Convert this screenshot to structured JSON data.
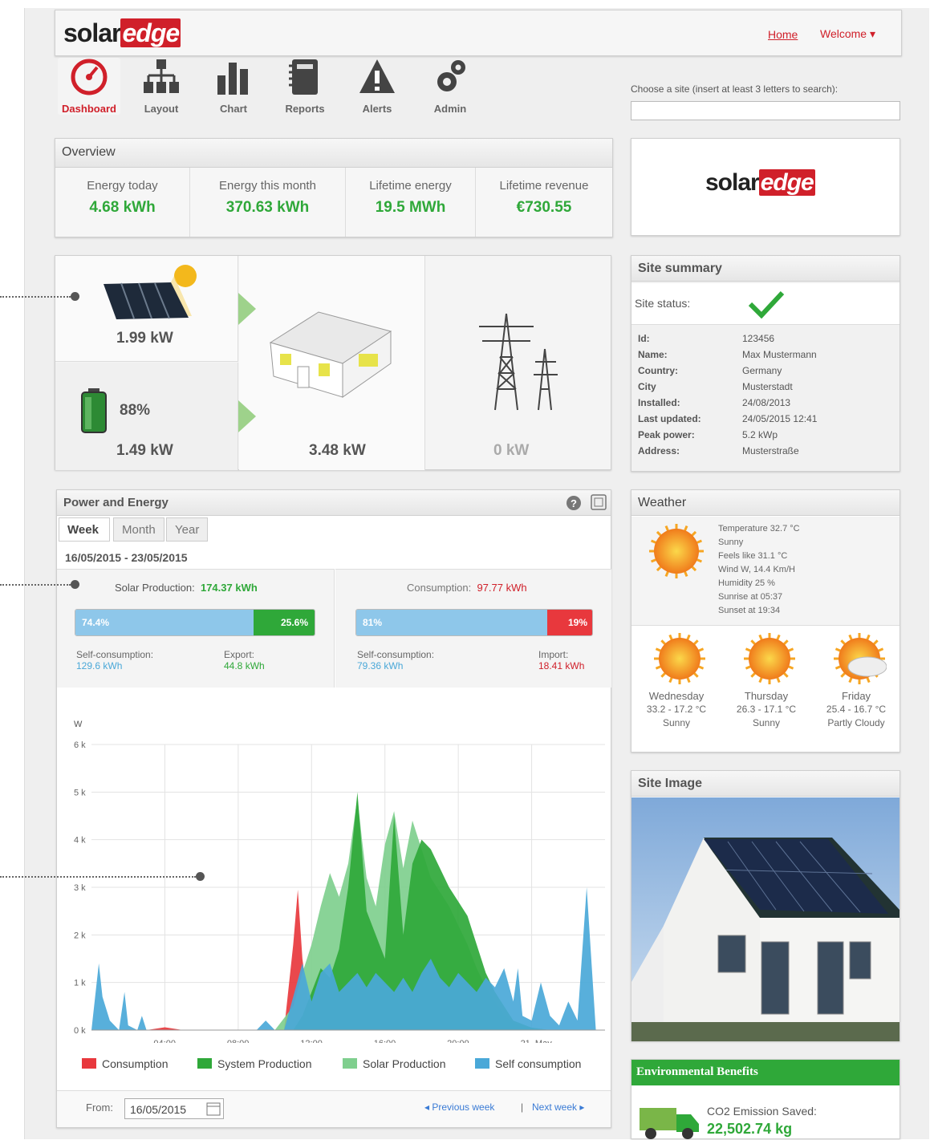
{
  "brand": {
    "solar": "solar",
    "edge": "edge"
  },
  "topnav": {
    "home": "Home",
    "welcome": "Welcome ▾"
  },
  "nav": [
    {
      "label": "Dashboard",
      "icon": "gauge-icon",
      "active": true
    },
    {
      "label": "Layout",
      "icon": "layout-icon"
    },
    {
      "label": "Chart",
      "icon": "chart-icon"
    },
    {
      "label": "Reports",
      "icon": "reports-icon"
    },
    {
      "label": "Alerts",
      "icon": "alert-icon"
    },
    {
      "label": "Admin",
      "icon": "gear-icon"
    }
  ],
  "search": {
    "label": "Choose a site (insert at least 3 letters to search):",
    "value": ""
  },
  "overview": {
    "title": "Overview",
    "items": [
      {
        "label": "Energy today",
        "value": "4.68 kWh"
      },
      {
        "label": "Energy this month",
        "value": "370.63 kWh"
      },
      {
        "label": "Lifetime energy",
        "value": "19.5 MWh"
      },
      {
        "label": "Lifetime revenue",
        "value": "€730.55"
      }
    ]
  },
  "flow": {
    "solar": "1.99 kW",
    "battery_pct": "88%",
    "battery": "1.49 kW",
    "house": "3.48 kW",
    "grid": "0 kW"
  },
  "summary": {
    "title": "Site summary",
    "status_label": "Site status:",
    "rows": [
      {
        "k": "Id:",
        "v": "123456"
      },
      {
        "k": "Name:",
        "v": "Max Mustermann"
      },
      {
        "k": "Country:",
        "v": "Germany"
      },
      {
        "k": "City",
        "v": "Musterstadt"
      },
      {
        "k": "Installed:",
        "v": "24/08/2013"
      },
      {
        "k": "Last updated:",
        "v": "24/05/2015 12:41"
      },
      {
        "k": "Peak power:",
        "v": "5.2 kWp"
      },
      {
        "k": "Address:",
        "v": "Musterstraße"
      }
    ]
  },
  "pe": {
    "title": "Power and Energy",
    "tabs": [
      "Week",
      "Month",
      "Year"
    ],
    "range": "16/05/2015 - 23/05/2015",
    "solar_label": "Solar Production:",
    "solar_value": "174.37 kWh",
    "solar_left_pct": "74.4%",
    "solar_right_pct": "25.6%",
    "self_label": "Self-consumption:",
    "self_value": "129.6 kWh",
    "export_label": "Export:",
    "export_value": "44.8 kWh",
    "cons_label": "Consumption:",
    "cons_value": "97.77 kWh",
    "cons_left_pct": "81%",
    "cons_right_pct": "19%",
    "self2_label": "Self-consumption:",
    "self2_value": "79.36 kWh",
    "import_label": "Import:",
    "import_value": "18.41 kWh",
    "from_label": "From:",
    "from_value": "16/05/2015",
    "prev": "◂ Previous week",
    "sep": "|",
    "next": "Next week ▸"
  },
  "chart_data": {
    "type": "area",
    "ylabel": "W",
    "yticks": [
      "0 k",
      "1 k",
      "2 k",
      "3 k",
      "4 k",
      "5 k",
      "6 k"
    ],
    "ylim": [
      0,
      6000
    ],
    "xticks": [
      "04:00",
      "08:00",
      "12:00",
      "16:00",
      "20:00",
      "21. May"
    ],
    "series": [
      {
        "name": "Consumption",
        "color": "#e8383d",
        "x": [
          0,
          6,
          8,
          10,
          15,
          18,
          21,
          22,
          22.5,
          23,
          24,
          25,
          30,
          34,
          44,
          46,
          50,
          55,
          56
        ],
        "y": [
          0,
          0,
          60,
          0,
          0,
          0,
          0,
          1800,
          2950,
          1500,
          0,
          0,
          0,
          0,
          0,
          0,
          0,
          0,
          0
        ]
      },
      {
        "name": "Solar Production",
        "color": "#7fcf8e",
        "x": [
          0,
          20,
          22,
          23,
          24,
          25,
          26,
          27,
          28,
          28.5,
          29,
          29.5,
          30,
          31,
          32,
          33,
          34,
          35,
          36,
          37,
          38,
          39,
          40,
          41,
          42,
          43,
          44,
          45,
          46,
          48,
          50,
          56
        ],
        "y": [
          0,
          0,
          500,
          1200,
          1800,
          2600,
          3300,
          2800,
          3500,
          4200,
          4900,
          4000,
          3200,
          2600,
          3900,
          4600,
          3400,
          4400,
          3800,
          3200,
          2900,
          2600,
          2200,
          1800,
          1300,
          900,
          600,
          300,
          150,
          50,
          0,
          0
        ]
      },
      {
        "name": "System Production",
        "color": "#2fa839",
        "x": [
          0,
          22,
          23,
          25,
          26,
          27,
          28,
          29,
          30,
          31,
          32,
          33,
          34,
          35,
          36,
          37,
          38,
          39,
          40,
          41,
          42,
          43,
          44,
          45,
          46,
          48,
          50,
          56
        ],
        "y": [
          0,
          0,
          300,
          1300,
          1100,
          1700,
          3000,
          5000,
          2500,
          2000,
          1500,
          4500,
          2000,
          3500,
          4000,
          3800,
          3400,
          3000,
          2700,
          2400,
          1800,
          1200,
          800,
          500,
          200,
          50,
          0,
          0
        ]
      },
      {
        "name": "Self consumption",
        "color": "#4aa8d8",
        "x": [
          0,
          0.8,
          1.2,
          2,
          3,
          3.6,
          4,
          5,
          5.5,
          6,
          7,
          8,
          9,
          10,
          12,
          13,
          14,
          15,
          16,
          18,
          19,
          20,
          21,
          22,
          23,
          24,
          25,
          26,
          27,
          28,
          29,
          30,
          31,
          32,
          33,
          34,
          35,
          36,
          37,
          38,
          39,
          40,
          41,
          42,
          43,
          44,
          45,
          46,
          46.5,
          47,
          48,
          49,
          50,
          51,
          52,
          53,
          54,
          55,
          56
        ],
        "y": [
          0,
          1400,
          700,
          200,
          0,
          800,
          100,
          0,
          300,
          0,
          0,
          0,
          0,
          0,
          0,
          0,
          0,
          0,
          0,
          0,
          200,
          0,
          0,
          700,
          1400,
          600,
          1200,
          1400,
          800,
          1000,
          1200,
          900,
          1200,
          1000,
          800,
          1100,
          800,
          1200,
          1500,
          1100,
          900,
          1200,
          1000,
          800,
          1100,
          900,
          1300,
          600,
          1300,
          300,
          200,
          1000,
          300,
          100,
          600,
          200,
          3000,
          0,
          0
        ]
      }
    ]
  },
  "weather": {
    "title": "Weather",
    "now": [
      "Temperature 32.7 °C",
      "Sunny",
      "Feels like 31.1 °C",
      "Wind W, 14.4 Km/H",
      "Humidity 25 %",
      "Sunrise at 05:37",
      "Sunset at 19:34"
    ],
    "days": [
      {
        "day": "Wednesday",
        "temp": "33.2 - 17.2 °C",
        "cond": "Sunny"
      },
      {
        "day": "Thursday",
        "temp": "26.3 - 17.1 °C",
        "cond": "Sunny"
      },
      {
        "day": "Friday",
        "temp": "25.4 - 16.7 °C",
        "cond": "Partly Cloudy"
      }
    ]
  },
  "site_image": {
    "title": "Site Image"
  },
  "env": {
    "title": "Environmental Benefits",
    "co2_label": "CO2 Emission Saved:",
    "co2_value": "22,502.74 kg"
  }
}
